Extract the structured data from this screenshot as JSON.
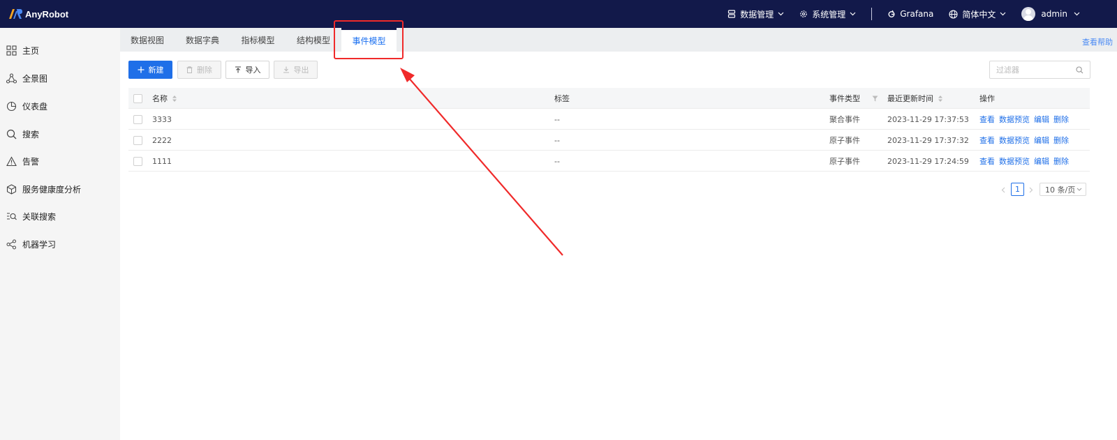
{
  "app": {
    "name": "AnyRobot"
  },
  "topbar": {
    "data_management": "数据管理",
    "system_management": "系统管理",
    "grafana": "Grafana",
    "language": "简体中文",
    "user": "admin"
  },
  "sidebar": {
    "items": [
      {
        "label": "主页",
        "icon": "grid-icon"
      },
      {
        "label": "全景图",
        "icon": "network-icon"
      },
      {
        "label": "仪表盘",
        "icon": "pie-chart-icon"
      },
      {
        "label": "搜索",
        "icon": "search-icon"
      },
      {
        "label": "告警",
        "icon": "warning-icon"
      },
      {
        "label": "服务健康度分析",
        "icon": "codesandbox-icon"
      },
      {
        "label": "关联搜索",
        "icon": "list-search-icon"
      },
      {
        "label": "机器学习",
        "icon": "nodes-icon"
      }
    ]
  },
  "tabs": [
    {
      "label": "数据视图",
      "active": false
    },
    {
      "label": "数据字典",
      "active": false
    },
    {
      "label": "指标模型",
      "active": false
    },
    {
      "label": "结构模型",
      "active": false
    },
    {
      "label": "事件模型",
      "active": true
    }
  ],
  "help_link": "查看帮助",
  "toolbar": {
    "new_label": "新建",
    "delete_label": "删除",
    "import_label": "导入",
    "export_label": "导出",
    "filter_placeholder": "过滤器"
  },
  "table": {
    "headers": {
      "name": "名称",
      "tags": "标签",
      "event_type": "事件类型",
      "updated": "最近更新时间",
      "actions": "操作"
    },
    "rows": [
      {
        "name": "3333",
        "tags": "--",
        "event_type": "聚合事件",
        "updated": "2023-11-29 17:37:53"
      },
      {
        "name": "2222",
        "tags": "--",
        "event_type": "原子事件",
        "updated": "2023-11-29 17:37:32"
      },
      {
        "name": "1111",
        "tags": "--",
        "event_type": "原子事件",
        "updated": "2023-11-29 17:24:59"
      }
    ],
    "actions": {
      "view": "查看",
      "preview": "数据预览",
      "edit": "编辑",
      "delete": "删除"
    }
  },
  "pagination": {
    "current_page": "1",
    "page_size": "10 条/页"
  },
  "colors": {
    "topbar": "#12194a",
    "primary": "#1f6fe8",
    "annotation": "#f02a2a"
  }
}
